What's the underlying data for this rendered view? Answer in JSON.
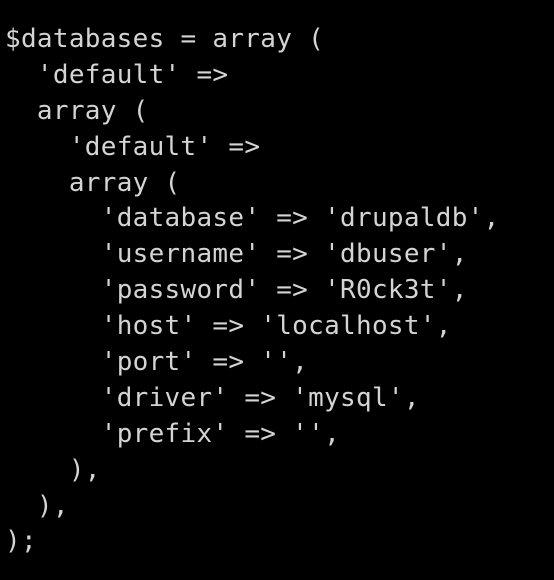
{
  "theme": {
    "background": "#000000",
    "text_color": "#d4d4d4"
  },
  "code": {
    "language": "php",
    "lines": [
      {
        "indent": "",
        "text": "$databases = array ("
      },
      {
        "indent": "  ",
        "text": "'default' =>"
      },
      {
        "indent": "  ",
        "text": "array ("
      },
      {
        "indent": "    ",
        "text": "'default' =>"
      },
      {
        "indent": "    ",
        "text": "array ("
      },
      {
        "indent": "      ",
        "text": "'database' => 'drupaldb',"
      },
      {
        "indent": "      ",
        "text": "'username' => 'dbuser',"
      },
      {
        "indent": "      ",
        "text": "'password' => 'R0ck3t',"
      },
      {
        "indent": "      ",
        "text": "'host' => 'localhost',"
      },
      {
        "indent": "      ",
        "text": "'port' => '',"
      },
      {
        "indent": "      ",
        "text": "'driver' => 'mysql',"
      },
      {
        "indent": "      ",
        "text": "'prefix' => '',"
      },
      {
        "indent": "    ",
        "text": "),"
      },
      {
        "indent": "  ",
        "text": "),"
      },
      {
        "indent": "",
        "text": ");"
      }
    ]
  }
}
